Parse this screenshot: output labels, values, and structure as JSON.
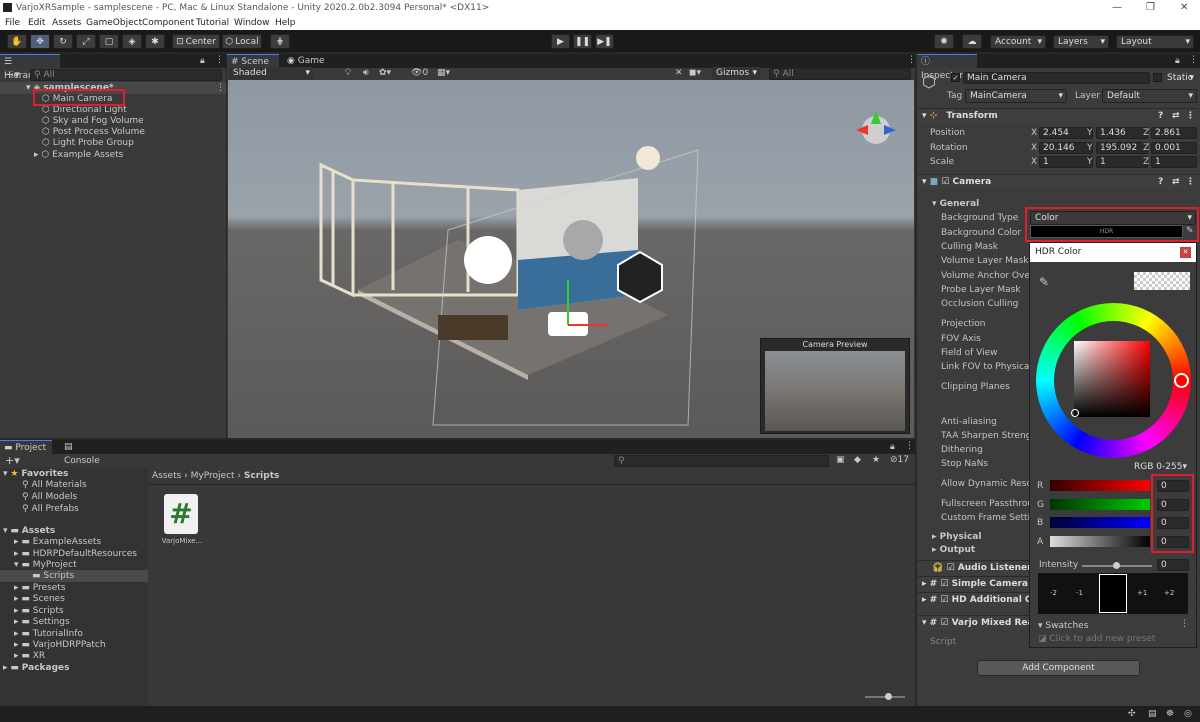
{
  "window": {
    "title": "VarjoXRSample - samplescene - PC, Mac & Linux Standalone - Unity 2020.2.0b2.3094 Personal* <DX11>"
  },
  "menu": [
    "File",
    "Edit",
    "Assets",
    "GameObject",
    "Component",
    "Tutorial",
    "Window",
    "Help"
  ],
  "toolbar": {
    "center": "Center",
    "local": "Local",
    "account": "Account",
    "layers": "Layers",
    "layout": "Layout"
  },
  "hierarchy": {
    "tab": "Hierarchy",
    "search_placeholder": "All",
    "scene": "samplescene*",
    "items": [
      "Main Camera",
      "Directional Light",
      "Sky and Fog Volume",
      "Post Process Volume",
      "Light Probe Group",
      "Example Assets"
    ]
  },
  "scene": {
    "tab_scene": "Scene",
    "tab_game": "Game",
    "shaded": "Shaded",
    "twod": "2D",
    "fx_count": "0",
    "gizmos": "Gizmos",
    "search_placeholder": "All",
    "camera_preview": "Camera Preview"
  },
  "project": {
    "tab_project": "Project",
    "tab_console": "Console",
    "hidden_count": "17",
    "favorites": "Favorites",
    "fav_items": [
      "All Materials",
      "All Models",
      "All Prefabs"
    ],
    "assets": "Assets",
    "tree": [
      "ExampleAssets",
      "HDRPDefaultResources",
      "MyProject",
      "Scripts",
      "Presets",
      "Scenes",
      "Scripts",
      "Settings",
      "TutorialInfo",
      "VarjoHDRPPatch",
      "XR"
    ],
    "packages": "Packages",
    "breadcrumb": [
      "Assets",
      "MyProject",
      "Scripts"
    ],
    "file_name": "VarjoMixe..."
  },
  "inspector": {
    "tab": "Inspector",
    "object_name": "Main Camera",
    "static": "Static",
    "tag_label": "Tag",
    "tag": "MainCamera",
    "layer_label": "Layer",
    "layer": "Default",
    "transform": "Transform",
    "position_label": "Position",
    "rotation_label": "Rotation",
    "scale_label": "Scale",
    "position": [
      "2.454",
      "1.436",
      "2.861"
    ],
    "rotation": [
      "20.146",
      "195.092",
      "0.001"
    ],
    "scale": [
      "1",
      "1",
      "1"
    ],
    "axes": [
      "X",
      "Y",
      "Z"
    ],
    "camera": "Camera",
    "general": "General",
    "bg_type_label": "Background Type",
    "bg_type": "Color",
    "bg_color_label": "Background Color",
    "hdr": "HDR",
    "props": [
      "Culling Mask",
      "Volume Layer Mask",
      "Volume Anchor Overri",
      "Probe Layer Mask",
      "Occlusion Culling"
    ],
    "props2": [
      "Projection",
      "FOV Axis",
      "Field of View",
      "Link FOV to Physical C"
    ],
    "clipping": "Clipping Planes",
    "props3": [
      "Anti-aliasing",
      "TAA Sharpen Strength",
      "Dithering",
      "Stop NaNs"
    ],
    "props4": [
      "Allow Dynamic Resolu",
      "Fullscreen Passthroug",
      "Custom Frame Setting"
    ],
    "physical": "Physical",
    "output": "Output",
    "components": [
      "Audio Listener",
      "Simple Camera C",
      "HD Additional Ca",
      "Varjo Mixed Real"
    ],
    "script_label": "Script",
    "add_component": "Add Component"
  },
  "color_picker": {
    "title": "HDR Color",
    "mode": "RGB 0-255",
    "channels": [
      "R",
      "G",
      "B",
      "A"
    ],
    "values": [
      "0",
      "0",
      "0",
      "0"
    ],
    "intensity_label": "Intensity",
    "intensity": "0",
    "exposure": [
      "-2",
      "-1",
      "+1",
      "+2"
    ],
    "swatches": "Swatches",
    "swatches_hint": "Click to add new preset"
  }
}
